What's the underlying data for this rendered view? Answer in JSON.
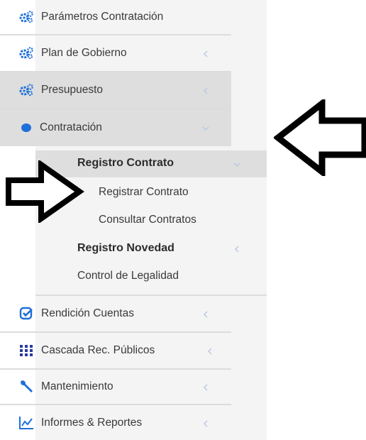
{
  "menu": {
    "items": [
      {
        "label": "Parámetros Contratación",
        "icon": "gears-icon"
      },
      {
        "label": "Plan de Gobierno",
        "icon": "gears-icon"
      },
      {
        "label": "Presupuesto",
        "icon": "gears-icon"
      },
      {
        "label": "Contratación",
        "icon": "circle-icon"
      },
      {
        "label": "Rendición Cuentas",
        "icon": "checkbox-icon"
      },
      {
        "label": "Cascada Rec. Públicos",
        "icon": "grid-icon"
      },
      {
        "label": "Mantenimiento",
        "icon": "wrench-icon"
      },
      {
        "label": "Informes & Reportes",
        "icon": "chart-icon"
      }
    ],
    "contratacion_sub": {
      "registro_contrato": "Registro Contrato",
      "registrar_contrato": "Registrar Contrato",
      "consultar_contratos": "Consultar Contratos",
      "registro_novedad": "Registro Novedad",
      "control_legalidad": "Control de Legalidad"
    }
  },
  "colors": {
    "icon_blue": "#1e6fd9",
    "grid_blue": "#2a3a9c",
    "row_gray": "#dedede",
    "sidebar_bg": "#f4f4f4",
    "chevron": "#b8c8e0"
  }
}
